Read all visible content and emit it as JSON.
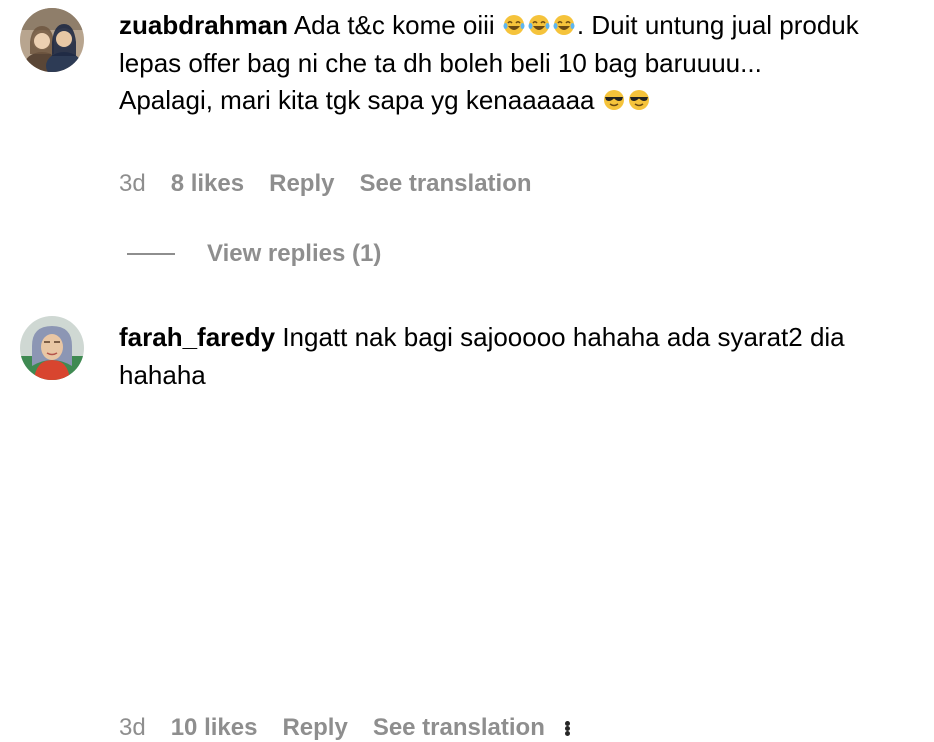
{
  "comments": [
    {
      "username": "zuabdrahman",
      "text_segments": [
        "Ada t&c kome oiii ",
        ". Duit untung jual produk lepas offer bag ni che ta dh boleh beli 10 bag baruuuu...\nApalagi, mari kita tgk sapa yg kenaaaaaa "
      ],
      "emojis": [
        "face-with-tears-of-joy",
        "face-with-tears-of-joy",
        "face-with-tears-of-joy",
        "smiling-face-with-sunglasses",
        "smiling-face-with-sunglasses"
      ],
      "time": "3d",
      "likes": "8 likes",
      "reply_label": "Reply",
      "translate_label": "See translation",
      "view_replies_label": "View replies (1)"
    },
    {
      "username": "farah_faredy",
      "text": "Ingatt nak bagi sajooooo hahaha ada syarat2 dia hahaha",
      "time": "3d",
      "likes": "10 likes",
      "reply_label": "Reply",
      "translate_label": "See translation",
      "more_icon": "more-horizontal-icon"
    }
  ],
  "colors": {
    "text": "#000000",
    "meta": "#8e8e8e",
    "background": "#ffffff"
  }
}
